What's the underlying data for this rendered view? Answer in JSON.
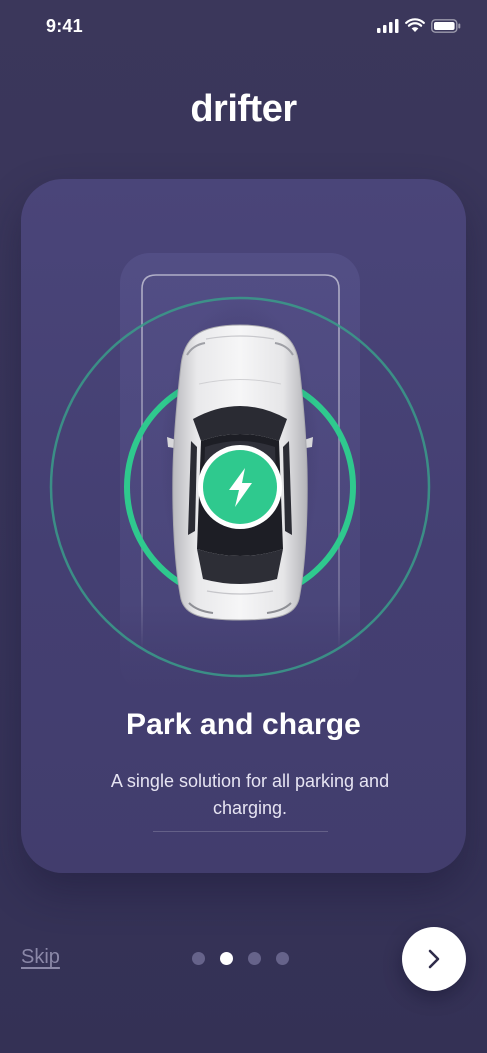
{
  "status_bar": {
    "time": "9:41",
    "icons": [
      "signal-icon",
      "wifi-icon",
      "battery-icon"
    ]
  },
  "app": {
    "logo_text": "drifter"
  },
  "onboarding": {
    "title": "Park and charge",
    "subtitle": "A single solution for all parking and charging.",
    "illustration_icon": "lightning-bolt-icon"
  },
  "footer": {
    "skip_label": "Skip",
    "next_icon": "chevron-right-icon",
    "page_count": 4,
    "active_page_index": 1
  },
  "colors": {
    "background": "#3b375b",
    "card": "#4a4579",
    "accent_green": "#2fc98e",
    "ring_teal": "#3a9c8a",
    "text_primary": "#ffffff",
    "dot_inactive": "#66638a"
  }
}
